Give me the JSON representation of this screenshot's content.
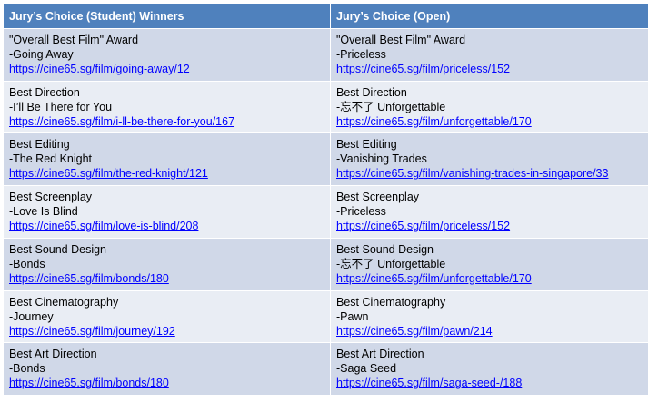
{
  "table": {
    "headers": [
      "Jury’s Choice (Student) Winners",
      "Jury’s Choice (Open)"
    ],
    "rows": [
      [
        {
          "award": "\"Overall Best Film\" Award",
          "film": "-Going Away",
          "link": "https://cine65.sg/film/going-away/12"
        },
        {
          "award": "\"Overall Best Film\" Award",
          "film": "-Priceless",
          "link": "https://cine65.sg/film/priceless/152"
        }
      ],
      [
        {
          "award": "Best Direction",
          "film": "-I’ll Be There for You",
          "link": "https://cine65.sg/film/i-ll-be-there-for-you/167"
        },
        {
          "award": "Best Direction",
          "film": "-忘不了 Unforgettable",
          "link": "https://cine65.sg/film/unforgettable/170"
        }
      ],
      [
        {
          "award": "Best Editing",
          "film": "-The Red Knight",
          "link": "https://cine65.sg/film/the-red-knight/121"
        },
        {
          "award": "Best Editing",
          "film": "-Vanishing Trades",
          "link": "https://cine65.sg/film/vanishing-trades-in-singapore/33"
        }
      ],
      [
        {
          "award": "Best Screenplay",
          "film": "-Love Is Blind",
          "link": "https://cine65.sg/film/love-is-blind/208"
        },
        {
          "award": "Best Screenplay",
          "film": "-Priceless",
          "link": "https://cine65.sg/film/priceless/152"
        }
      ],
      [
        {
          "award": "Best Sound Design",
          "film": "-Bonds",
          "link": "https://cine65.sg/film/bonds/180"
        },
        {
          "award": "Best Sound Design",
          "film": "-忘不了 Unforgettable",
          "link": "https://cine65.sg/film/unforgettable/170"
        }
      ],
      [
        {
          "award": "Best Cinematography",
          "film": "-Journey",
          "link": "https://cine65.sg/film/journey/192"
        },
        {
          "award": "Best Cinematography",
          "film": "-Pawn",
          "link": "https://cine65.sg/film/pawn/214"
        }
      ],
      [
        {
          "award": "Best Art Direction",
          "film": "-Bonds",
          "link": "https://cine65.sg/film/bonds/180"
        },
        {
          "award": "Best Art Direction",
          "film": "-Saga Seed",
          "link": "https://cine65.sg/film/saga-seed-/188"
        }
      ]
    ]
  },
  "colors": {
    "header_bg": "#4f81bd",
    "row_dark": "#d0d8e8",
    "row_light": "#e9edf4",
    "link": "#0000ff"
  }
}
